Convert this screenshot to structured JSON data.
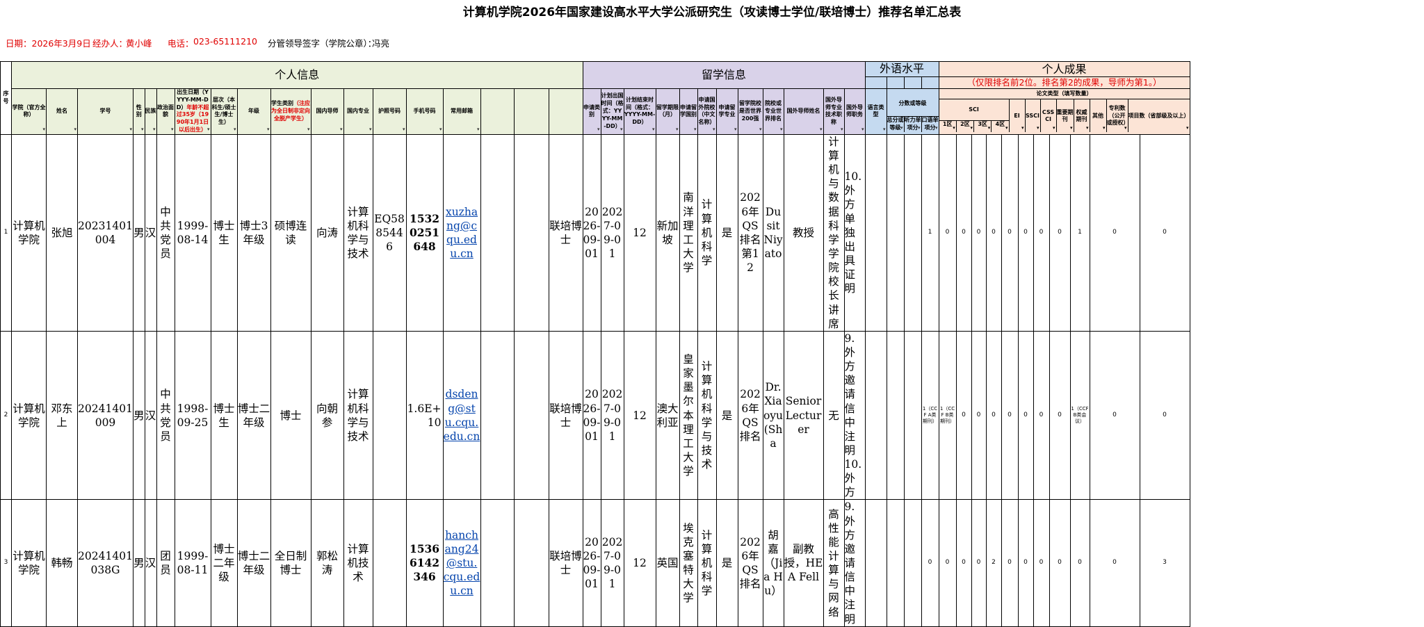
{
  "title": "计算机学院2026年国家建设高水平大学公派研究生（攻读博士学位/联培博士）推荐名单汇总表",
  "info": {
    "date": "日期：2026年3月9日",
    "handler_label": "经办人：",
    "handler": "黄小峰",
    "phone_label": "电话：",
    "phone": "023-65111210",
    "leader_label": "分管领导签字（学院公章）：",
    "leader": "冯亮"
  },
  "groups": {
    "personal": "个人信息",
    "study_abroad": "留学信息",
    "language": "外语水平",
    "achievement": "个人成果",
    "achievement_note": "（仅限排名前2位。排名第2的成果，导师为第1。）",
    "paper_type": "论文类型（填写数量）",
    "score": "分数或等级",
    "sci": "SCI"
  },
  "headers": {
    "idx": "序号",
    "college": "学院（官方全称）",
    "name": "姓名",
    "student_id": "学号",
    "gender": "性别",
    "ethnicity": "民族",
    "political": "政治面貌",
    "birth": "出生日期（YYYY-MM-DD）",
    "birth_note": "年龄不超过35岁（1990年1月1日以后出生）",
    "level": "层次（本科生/硕士生/博士生）",
    "grade": "年级",
    "type": "学生类别",
    "type_note": "（注应为全日制非定向全脱产学生）",
    "advisor": "国内导师",
    "major": "国内专业",
    "passport": "护照号码",
    "mobile": "手机号码",
    "email": "常用邮箱",
    "apply_type": "申请类别",
    "depart": "计划出国时间（格式：YYYY-MM-DD）",
    "end": "计划结束时间（格式：YYYY-MM-DD）",
    "period": "留学期限（月）",
    "country": "申请留学国别",
    "school": "申请国外院校（中文名称）",
    "foreign_major": "申请留学专业",
    "top200": "留学院校是否世界200强",
    "rank": "院校或专业世界排名",
    "foreign_advisor": "国外导师姓名",
    "advisor_title": "国外导师专业技术职称",
    "advisor_post": "国外导师职务",
    "lang_type": "语言类型",
    "total": "总分或等级",
    "listen": "听力单项分",
    "speak": "口语单项分",
    "sci1": "1区",
    "sci2": "2区",
    "sci3": "3区",
    "sci4": "4区",
    "ei": "EI",
    "ssci": "SSCI",
    "cssci": "CSSCI",
    "core": "重要期刊",
    "auth": "权威期刊",
    "other": "其他",
    "patent": "专利数（公开或授权）",
    "project": "项目数（省部级及以上）"
  },
  "rows": [
    {
      "idx": "1",
      "college": "计算机学院",
      "name": "张旭",
      "student_id": "20231401004",
      "gender": "男",
      "ethnicity": "汉",
      "political": "中共党员",
      "birth": "1999-08-14",
      "level": "博士生",
      "grade": "博士3年级",
      "type": "硕博连读",
      "advisor": "向涛",
      "major": "计算机科学与技术",
      "passport": "EQ5885446",
      "mobile": "15320251648",
      "email": "xuzhang@cqu.edu.cn",
      "apply_type": "联培博士",
      "depart": "2026-09-01",
      "end": "2027-09-01",
      "period": "12",
      "country": "新加坡",
      "school": "南洋理工大学",
      "foreign_major": "计算机科学",
      "top200": "是",
      "rank": "2026年QS排名第12",
      "foreign_advisor": "Dusit Niyato",
      "advisor_title": "教授",
      "advisor_post": "计算机与数据科学学院校长讲席",
      "lang_type": "10. 外方单独出具证明",
      "total": "",
      "listen": "",
      "speak": "",
      "sci1": "1",
      "sci2": "0",
      "sci3": "0",
      "sci4": "0",
      "ei": "0",
      "ssci": "0",
      "cssci": "0",
      "core": "0",
      "auth": "0",
      "other": "1",
      "patent": "0",
      "project": "0"
    },
    {
      "idx": "2",
      "college": "计算机学院",
      "name": "邓东上",
      "student_id": "20241401009",
      "gender": "男",
      "ethnicity": "汉",
      "political": "中共党员",
      "birth": "1998-09-25",
      "level": "博士生",
      "grade": "博士二年级",
      "type": "博士",
      "advisor": "向朝参",
      "major": "计算机科学与技术",
      "passport": "",
      "mobile": "1.6E+10",
      "email": "dsdeng@stu.cqu.edu.cn",
      "apply_type": "联培博士",
      "depart": "2026-09-01",
      "end": "2027-09-01",
      "period": "12",
      "country": "澳大利亚",
      "school": "皇家墨尔本理工大学",
      "foreign_major": "计算机科学与技术",
      "top200": "是",
      "rank": "2026年QS排名",
      "foreign_advisor": "Dr. Xiaoyu (Sha",
      "advisor_title": "Senior Lecturer",
      "advisor_post": "无",
      "lang_type": "9. 外方邀请信中注明 10. 外方",
      "total": "",
      "listen": "",
      "speak": "",
      "sci1": "1（CCF A类期刊）",
      "sci2": "1（CCF B类期刊）",
      "sci3": "0",
      "sci4": "0",
      "ei": "0",
      "ssci": "0",
      "cssci": "0",
      "core": "0",
      "auth": "0",
      "other": "1（CCF B类会议）",
      "patent": "0",
      "project": "0"
    },
    {
      "idx": "3",
      "college": "计算机学院",
      "name": "韩畅",
      "student_id": "20241401038G",
      "gender": "男",
      "ethnicity": "汉",
      "political": "团员",
      "birth": "1999-08-11",
      "level": "博士二年级",
      "grade": "博士二年级",
      "type": "全日制博士",
      "advisor": "郭松涛",
      "major": "计算机技术",
      "passport": "",
      "mobile": "15366142346",
      "email": "hanchang24@stu.cqu.edu.cn",
      "apply_type": "联培博士",
      "depart": "2026-09-01",
      "end": "2027-09-01",
      "period": "12",
      "country": "英国",
      "school": "埃克塞特大学",
      "foreign_major": "计算机科学",
      "top200": "是",
      "rank": "2026年QS排名",
      "foreign_advisor": "胡嘉（Jia Hu）",
      "advisor_title": "副教授，HEA Fell",
      "advisor_post": "高性能计算与网络",
      "lang_type": "9. 外方邀请信中注明",
      "total": "",
      "listen": "",
      "speak": "",
      "sci1": "0",
      "sci2": "0",
      "sci3": "0",
      "sci4": "0",
      "ei": "2",
      "ssci": "0",
      "cssci": "0",
      "core": "0",
      "auth": "0",
      "other": "0",
      "patent": "0",
      "project": "3"
    }
  ],
  "colors": {
    "personal_bg": "#ebf1dc",
    "abroad_bg": "#d9d2e9",
    "language_bg": "#c5daf0",
    "achievement_bg": "#fce4d6",
    "highlight_red": "#e00000",
    "link_blue": "#0645ad"
  }
}
